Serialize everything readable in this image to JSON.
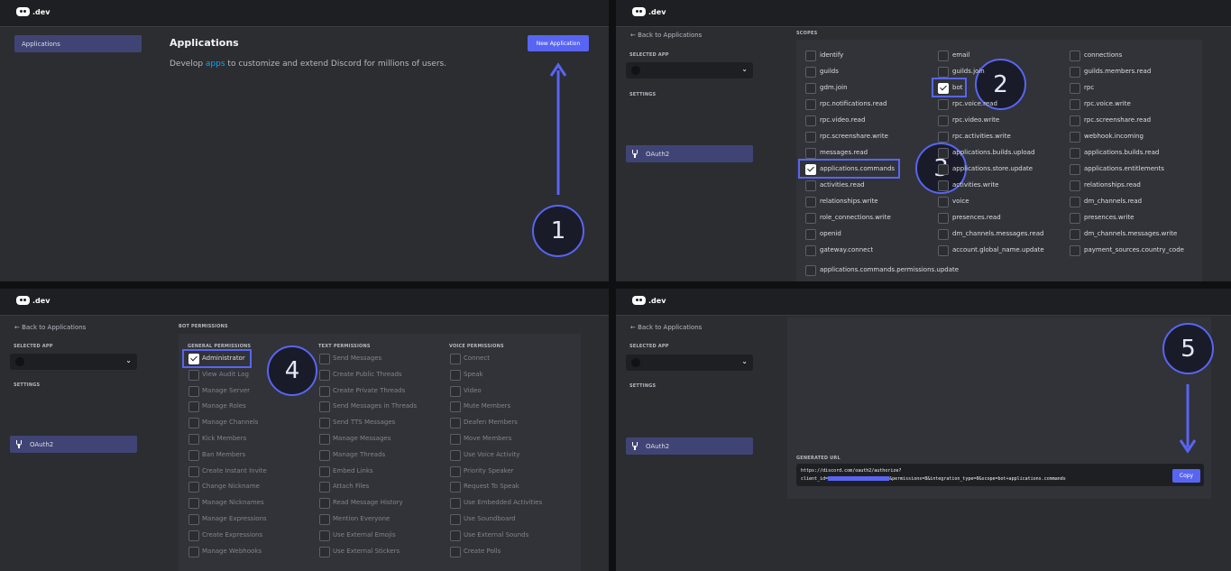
{
  "brand": {
    "logo_text": ".dev"
  },
  "panel1": {
    "sidebar_item": "Applications",
    "title": "Applications",
    "subtitle_prefix": "Develop ",
    "subtitle_link": "apps",
    "subtitle_suffix": " to customize and extend Discord for millions of users.",
    "new_app_button": "New Application",
    "step": "1"
  },
  "common": {
    "back": "← Back to Applications",
    "selected_app": "SELECTED APP",
    "settings": "SETTINGS",
    "oauth2": "OAuth2",
    "chevron": "⌄"
  },
  "panel2": {
    "scopes_label": "SCOPES",
    "step_bot": "2",
    "step_commands": "3",
    "scopes": [
      [
        "identify",
        "email",
        "connections"
      ],
      [
        "guilds",
        "guilds.join",
        "guilds.members.read"
      ],
      [
        "gdm.join",
        "bot",
        "rpc"
      ],
      [
        "rpc.notifications.read",
        "rpc.voice.read",
        "rpc.voice.write"
      ],
      [
        "rpc.video.read",
        "rpc.video.write",
        "rpc.screenshare.read"
      ],
      [
        "rpc.screenshare.write",
        "rpc.activities.write",
        "webhook.incoming"
      ],
      [
        "messages.read",
        "applications.builds.upload",
        "applications.builds.read"
      ],
      [
        "applications.commands",
        "applications.store.update",
        "applications.entitlements"
      ],
      [
        "activities.read",
        "activities.write",
        "relationships.read"
      ],
      [
        "relationships.write",
        "voice",
        "dm_channels.read"
      ],
      [
        "role_connections.write",
        "presences.read",
        "presences.write"
      ],
      [
        "openid",
        "dm_channels.messages.read",
        "dm_channels.messages.write"
      ],
      [
        "gateway.connect",
        "account.global_name.update",
        "payment_sources.country_code"
      ],
      [
        "applications.commands.permissions.update"
      ]
    ]
  },
  "panel3": {
    "bot_permissions_label": "BOT PERMISSIONS",
    "step": "4",
    "columns": [
      {
        "header": "GENERAL PERMISSIONS",
        "items": [
          "Administrator",
          "View Audit Log",
          "Manage Server",
          "Manage Roles",
          "Manage Channels",
          "Kick Members",
          "Ban Members",
          "Create Instant Invite",
          "Change Nickname",
          "Manage Nicknames",
          "Manage Expressions",
          "Create Expressions",
          "Manage Webhooks"
        ]
      },
      {
        "header": "TEXT PERMISSIONS",
        "items": [
          "Send Messages",
          "Create Public Threads",
          "Create Private Threads",
          "Send Messages in Threads",
          "Send TTS Messages",
          "Manage Messages",
          "Manage Threads",
          "Embed Links",
          "Attach Files",
          "Read Message History",
          "Mention Everyone",
          "Use External Emojis",
          "Use External Stickers"
        ]
      },
      {
        "header": "VOICE PERMISSIONS",
        "items": [
          "Connect",
          "Speak",
          "Video",
          "Mute Members",
          "Deafen Members",
          "Move Members",
          "Use Voice Activity",
          "Priority Speaker",
          "Request To Speak",
          "Use Embedded Activities",
          "Use Soundboard",
          "Use External Sounds",
          "Create Polls"
        ]
      }
    ]
  },
  "panel4": {
    "generated_url_label": "GENERATED URL",
    "url_line1": "https://discord.com/oauth2/authorize?",
    "url_line2_prefix": "client_id=",
    "url_line2_suffix": "&permissions=8&integration_type=0&scope=bot+applications.commands",
    "copy_button": "Copy",
    "step": "5"
  },
  "colors": {
    "accent": "#5865f2",
    "bg": "#2b2d31",
    "topbar": "#1e1f22",
    "sidebar_active": "#404475"
  }
}
